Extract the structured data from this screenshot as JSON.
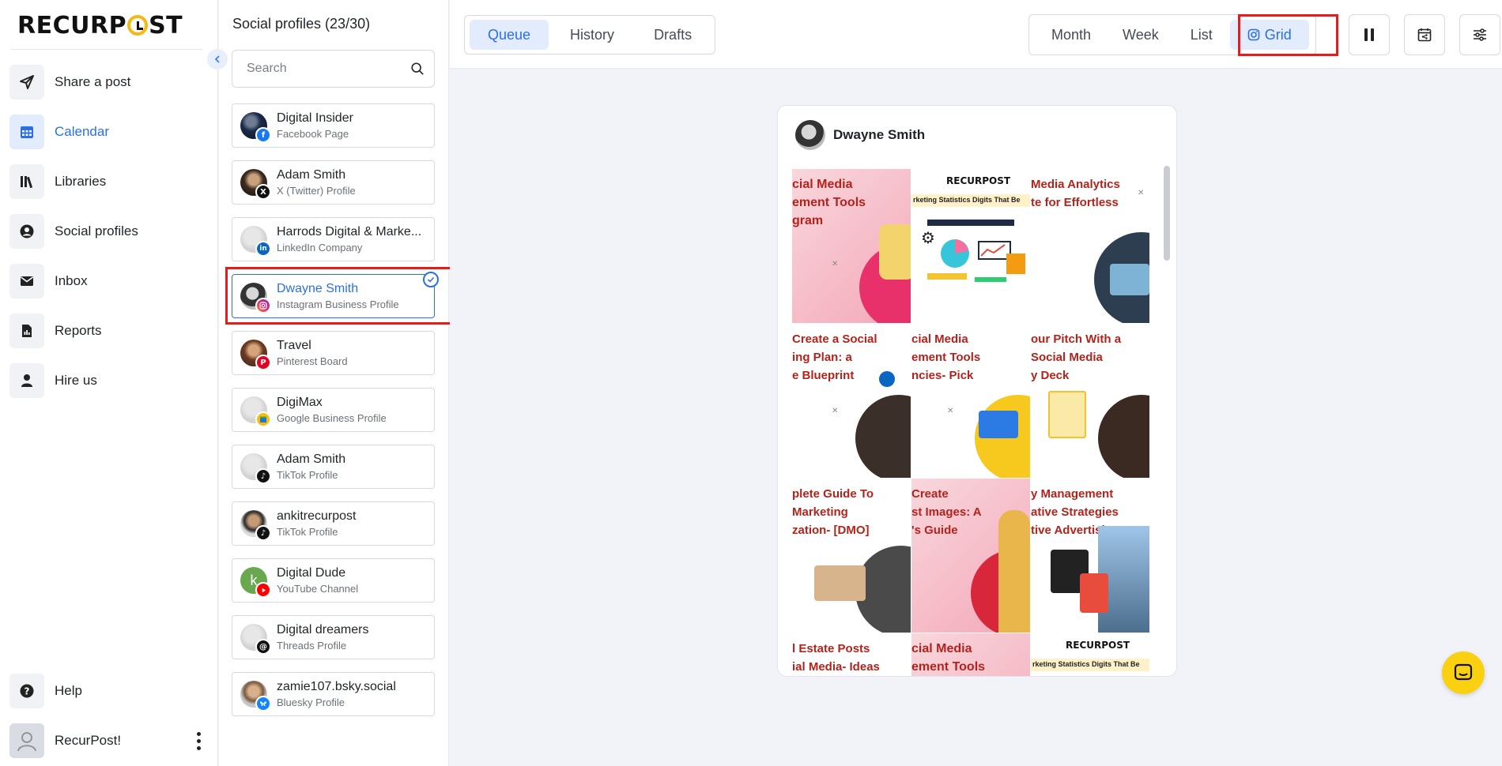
{
  "nav": {
    "logo": "RECURPOST",
    "items": [
      {
        "label": "Share a post",
        "icon": "send-icon"
      },
      {
        "label": "Calendar",
        "icon": "calendar-icon",
        "active": true
      },
      {
        "label": "Libraries",
        "icon": "library-icon"
      },
      {
        "label": "Social profiles",
        "icon": "profile-circle-icon"
      },
      {
        "label": "Inbox",
        "icon": "inbox-icon"
      },
      {
        "label": "Reports",
        "icon": "report-icon"
      },
      {
        "label": "Hire us",
        "icon": "person-icon"
      }
    ],
    "help_label": "Help",
    "user_name": "RecurPost!"
  },
  "profiles": {
    "title": "Social profiles (23/30)",
    "search_placeholder": "Search",
    "items": [
      {
        "name": "Digital Insider",
        "type": "Facebook Page",
        "network": "facebook",
        "color": "#1877f2"
      },
      {
        "name": "Adam Smith",
        "type": "X (Twitter) Profile",
        "network": "x",
        "color": "#111111"
      },
      {
        "name": "Harrods Digital & Marke...",
        "type": "LinkedIn Company",
        "network": "linkedin",
        "color": "#0a66c2"
      },
      {
        "name": "Dwayne Smith",
        "type": "Instagram Business Profile",
        "network": "instagram",
        "color": "#d62976",
        "selected": true
      },
      {
        "name": "Travel",
        "type": "Pinterest Board",
        "network": "pinterest",
        "color": "#e60023"
      },
      {
        "name": "DigiMax",
        "type": "Google Business Profile",
        "network": "google",
        "color": "#fbbc05"
      },
      {
        "name": "Adam Smith",
        "type": "TikTok Profile",
        "network": "tiktok",
        "color": "#111111"
      },
      {
        "name": "ankitrecurpost",
        "type": "TikTok Profile",
        "network": "tiktok",
        "color": "#111111"
      },
      {
        "name": "Digital Dude",
        "type": "YouTube Channel",
        "network": "youtube",
        "color": "#ff0000"
      },
      {
        "name": "Digital dreamers",
        "type": "Threads Profile",
        "network": "threads",
        "color": "#111111"
      },
      {
        "name": "zamie107.bsky.social",
        "type": "Bluesky Profile",
        "network": "bluesky",
        "color": "#1185fe"
      }
    ]
  },
  "topbar": {
    "tabs": [
      "Queue",
      "History",
      "Drafts"
    ],
    "active_tab": "Queue",
    "views": [
      "Month",
      "Week",
      "List",
      "Grid"
    ],
    "active_view": "Grid"
  },
  "grid": {
    "profile_name": "Dwayne Smith",
    "tiles": [
      {
        "text": "cial Media\nement Tools\ngram",
        "color": "#b3231b",
        "bg": "#f7c5cf"
      },
      {
        "text": "",
        "brand": "RECURPOST",
        "bar": "rketing Statistics Digits That Be",
        "bg": "#ffffff"
      },
      {
        "text": "Media Analytics\nte for Effortless",
        "color": "#b3231b",
        "bg": "#ffffff"
      },
      {
        "text": "Create a Social\ning Plan: a\ne Blueprint",
        "color": "#b3231b",
        "bg": "#ffffff"
      },
      {
        "text": "cial Media\nement Tools\nncies- Pick",
        "color": "#b3231b",
        "bg": "#ffffff"
      },
      {
        "text": "our Pitch With a\nSocial Media\ny Deck",
        "color": "#b3231b",
        "bg": "#ffffff"
      },
      {
        "text": "plete Guide To\nMarketing\nzation- [DMO]",
        "color": "#b3231b",
        "bg": "#ffffff"
      },
      {
        "text": "Create\nst Images: A\n's Guide",
        "color": "#b3231b",
        "bg": "#f7c5cf"
      },
      {
        "text": "y Management\native Strategies\ntive Advertising",
        "color": "#b3231b",
        "bg": "#ffffff"
      },
      {
        "text": "l Estate Posts\nial Media- Ideas",
        "color": "#b3231b",
        "bg": "#ffffff"
      },
      {
        "text": "cial Media\nement Tools",
        "color": "#b3231b",
        "bg": "#f7c5cf"
      },
      {
        "text": "",
        "brand": "RECURPOST",
        "bar": "rketing Statistics Digits That Be",
        "bg": "#ffffff"
      }
    ]
  },
  "colors": {
    "accent": "#2b6fe6",
    "highlight": "#e11d1d",
    "brand_yellow": "#f6b817"
  }
}
